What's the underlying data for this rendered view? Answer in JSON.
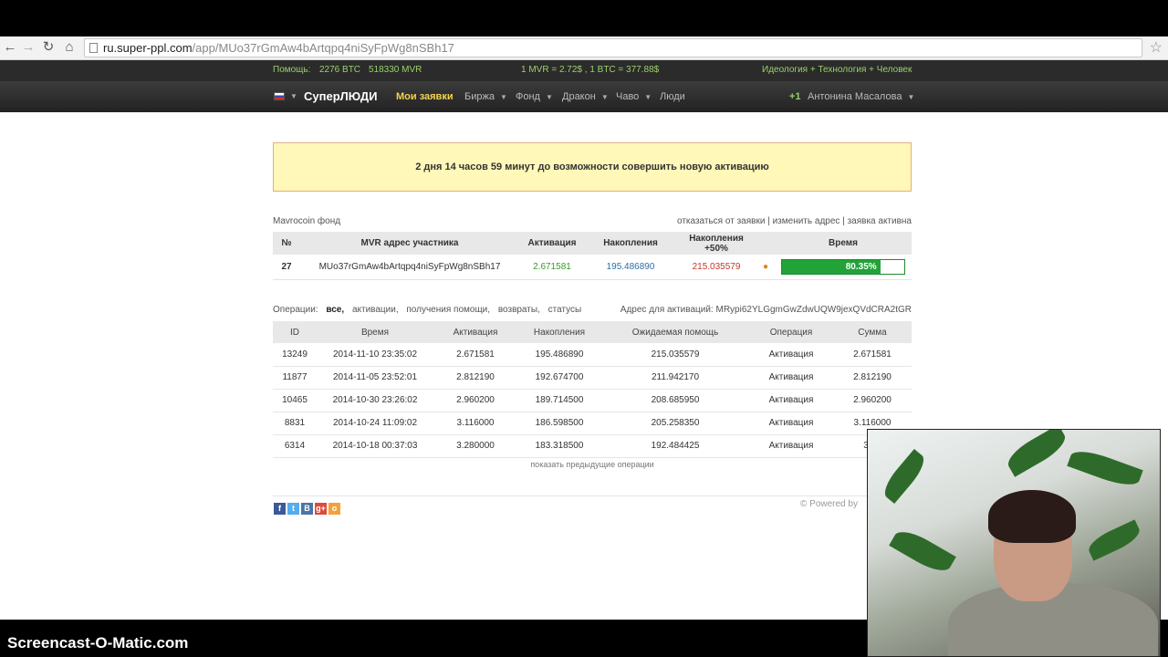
{
  "browser": {
    "url_host": "ru.super-ppl.com",
    "url_path": "/app/MUo37rGmAw4bArtqpq4niSyFpWg8nSBh17",
    "nav_icons": [
      "back-icon",
      "forward-icon",
      "reload-icon",
      "home-icon"
    ]
  },
  "topstrip": {
    "help": "Помощь:",
    "btc": "2276 BTC",
    "mvr": "518330 MVR",
    "rate": "1 MVR = 2.72$ , 1 BTC = 377.88$",
    "slogan": "Идеология + Технология + Человек"
  },
  "nav": {
    "brand": "СуперЛЮДИ",
    "my_requests": "Мои заявки",
    "exchange": "Биржа",
    "fund": "Фонд",
    "dragon": "Дракон",
    "faq": "Чаво",
    "people": "Люди",
    "plus_one": "+1",
    "user": "Антонина Масалова"
  },
  "notice": "2 дня 14 часов 59 минут до возможности совершить новую активацию",
  "fund": {
    "name": "Mavrocoin фонд",
    "cancel": "отказаться от заявки",
    "change_addr": "изменить адрес",
    "active": "заявка активна",
    "sep": "|"
  },
  "member_table": {
    "headers": [
      "№",
      "MVR адрес участника",
      "Активация",
      "Накопления",
      "Накопления +50%",
      "Время"
    ],
    "row": {
      "num": "27",
      "address": "MUo37rGmAw4bArtqpq4niSyFpWg8nSBh17",
      "activation": "2.671581",
      "savings": "195.486890",
      "savings50": "215.035579",
      "progress_text": "80.35%",
      "progress_fraction": 0.8035
    }
  },
  "ops": {
    "label": "Операции:",
    "filters": [
      "все,",
      "активации,",
      "получения помощи,",
      "возвраты,",
      "статусы"
    ],
    "address_label": "Адрес для активаций:",
    "address": "MRypi62YLGgmGwZdwUQW9jexQVdCRA2tGR"
  },
  "ops_table": {
    "headers": [
      "ID",
      "Время",
      "Активация",
      "Накопления",
      "Ожидаемая помощь",
      "Операция",
      "Сумма"
    ],
    "rows": [
      [
        "13249",
        "2014-11-10 23:35:02",
        "2.671581",
        "195.486890",
        "215.035579",
        "Активация",
        "2.671581"
      ],
      [
        "11877",
        "2014-11-05 23:52:01",
        "2.812190",
        "192.674700",
        "211.942170",
        "Активация",
        "2.812190"
      ],
      [
        "10465",
        "2014-10-30 23:26:02",
        "2.960200",
        "189.714500",
        "208.685950",
        "Активация",
        "2.960200"
      ],
      [
        "8831",
        "2014-10-24 11:09:02",
        "3.116000",
        "186.598500",
        "205.258350",
        "Активация",
        "3.116000"
      ],
      [
        "6314",
        "2014-10-18 00:37:03",
        "3.280000",
        "183.318500",
        "192.484425",
        "Активация",
        "3.28"
      ]
    ]
  },
  "more": "показать предыдущие операции",
  "powered": "© Powered by",
  "social": [
    {
      "name": "facebook-icon",
      "glyph": "f",
      "color": "#3b5998"
    },
    {
      "name": "twitter-icon",
      "glyph": "t",
      "color": "#55acee"
    },
    {
      "name": "vk-icon",
      "glyph": "B",
      "color": "#4c75a3"
    },
    {
      "name": "google-plus-icon",
      "glyph": "g+",
      "color": "#dd4b39"
    },
    {
      "name": "odnoklassniki-icon",
      "glyph": "o",
      "color": "#f4a13c"
    }
  ],
  "watermark": "Screencast-O-Matic.com"
}
